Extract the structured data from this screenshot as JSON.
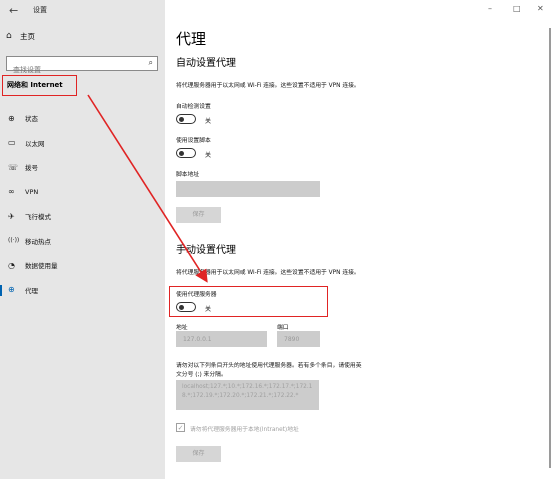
{
  "window": {
    "title": "设置",
    "back_glyph": "←",
    "controls": {
      "minimize": "–",
      "maximize": "□",
      "close": "✕"
    }
  },
  "sidebar": {
    "home": {
      "label": "主页",
      "icon": "home-icon"
    },
    "search": {
      "placeholder": "查找设置",
      "icon": "search-icon"
    },
    "section": "网络和 Internet",
    "items": [
      {
        "label": "状态",
        "icon": "globe-status-icon",
        "glyph": "⊕"
      },
      {
        "label": "以太网",
        "icon": "ethernet-icon",
        "glyph": "▭"
      },
      {
        "label": "拨号",
        "icon": "dialup-icon",
        "glyph": "☏"
      },
      {
        "label": "VPN",
        "icon": "vpn-icon",
        "glyph": "∞"
      },
      {
        "label": "飞行模式",
        "icon": "airplane-icon",
        "glyph": "✈"
      },
      {
        "label": "移动热点",
        "icon": "hotspot-icon",
        "glyph": "((·))"
      },
      {
        "label": "数据使用量",
        "icon": "data-usage-icon",
        "glyph": "◔"
      },
      {
        "label": "代理",
        "icon": "globe-proxy-icon",
        "glyph": "⊕",
        "active": true
      }
    ]
  },
  "main": {
    "title": "代理",
    "auto": {
      "heading": "自动设置代理",
      "description": "将代理服务器用于以太网或 Wi-Fi 连接。这些设置不适用于 VPN 连接。",
      "detect_label": "自动检测设置",
      "detect_state": "关",
      "script_label": "使用设置脚本",
      "script_state": "关",
      "script_addr_label": "脚本地址",
      "script_addr_value": "",
      "save_label": "保存"
    },
    "manual": {
      "heading": "手动设置代理",
      "description": "将代理服务器用于以太网或 Wi-Fi 连接。这些设置不适用于 VPN 连接。",
      "use_proxy_label": "使用代理服务器",
      "use_proxy_state": "关",
      "address_label": "地址",
      "address_value": "127.0.0.1",
      "port_label": "端口",
      "port_value": "7890",
      "exceptions_desc_line1": "请勿对以下列条目开头的地址使用代理服务器。若有多个条目，请使用英",
      "exceptions_desc_line2": "文分号 (;) 来分隔。",
      "exceptions_value": "localhost;127.*;10.*;172.16.*;172.17.*;172.18.*;172.19.*;172.20.*;172.21.*;172.22.*",
      "local_bypass_label": "请勿将代理服务器用于本地(Intranet)地址",
      "local_bypass_checked": true,
      "save_label": "保存"
    }
  },
  "colors": {
    "annotation": "#e02424",
    "accent": "#0063b1",
    "sidebar_bg": "#e6e6e6"
  }
}
